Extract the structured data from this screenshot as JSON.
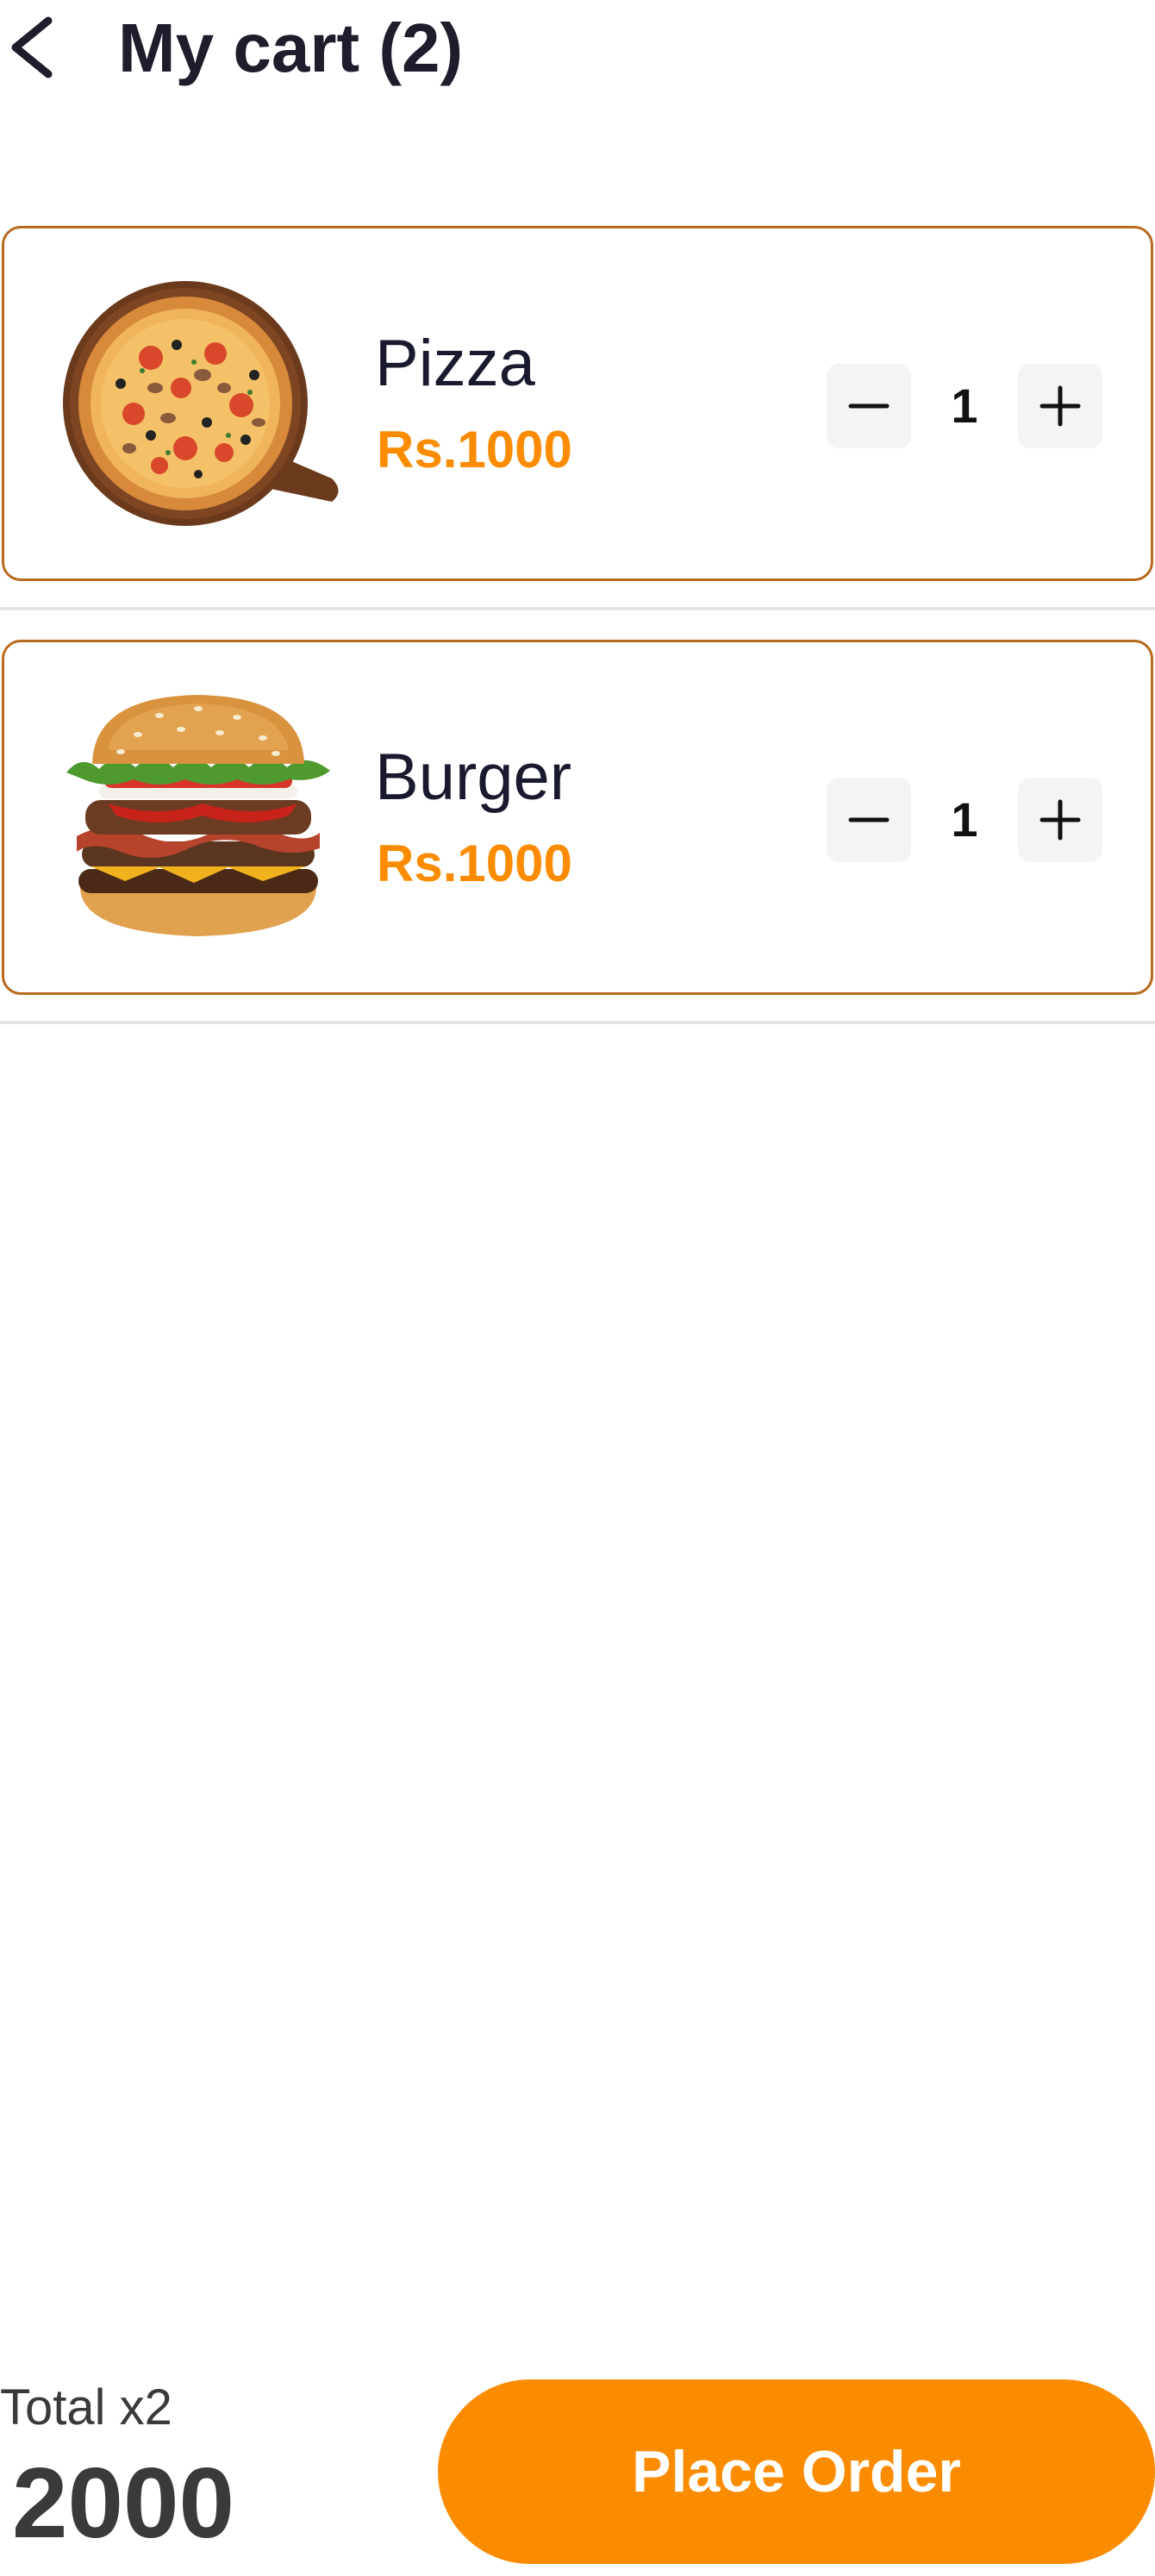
{
  "header": {
    "back_icon": "chevron-left-icon",
    "title": "My cart (2)"
  },
  "cart": {
    "items": [
      {
        "name": "Pizza",
        "price": "Rs.1000",
        "quantity": "1",
        "image": "pizza-image"
      },
      {
        "name": "Burger",
        "price": "Rs.1000",
        "quantity": "1",
        "image": "burger-image"
      }
    ]
  },
  "footer": {
    "total_label": "Total x2",
    "total_value": "2000",
    "place_order_label": "Place Order"
  },
  "colors": {
    "accent": "#fb8c00",
    "card_border": "#b86a1e",
    "stepper_bg": "#f4f4f6",
    "text_dark": "#1a1a2e"
  }
}
